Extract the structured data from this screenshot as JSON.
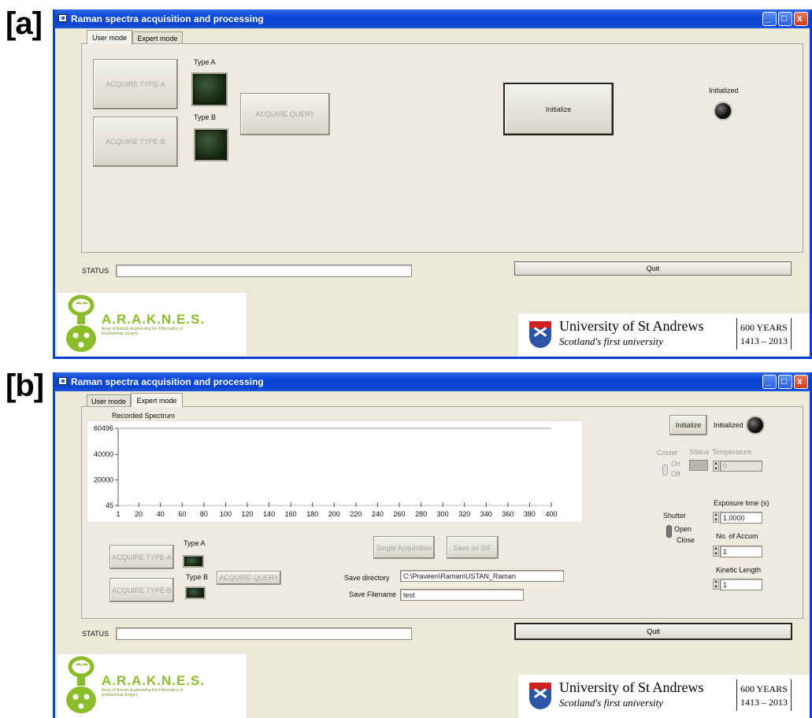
{
  "panel_a": {
    "label": "[a]",
    "title": "Raman spectra acquisition and processing",
    "tabs": [
      "User mode",
      "Expert mode"
    ],
    "buttons": {
      "acquire_a": "ACQUIRE TYPE-A",
      "acquire_b": "ACQUIRE TYPE-B",
      "acquire_query": "ACQUIRE QUERY",
      "initialize": "Initialize",
      "quit": "Quit"
    },
    "labels": {
      "type_a": "Type A",
      "type_b": "Type B",
      "initialized": "Initialized",
      "status": "STATUS"
    },
    "status_value": ""
  },
  "panel_b": {
    "label": "[b]",
    "title": "Raman spectra acquisition and processing",
    "tabs": [
      "User mode",
      "Expert mode"
    ],
    "chart_title": "Recorded Spectrum",
    "buttons": {
      "initialize": "Initialize",
      "acquire_a": "ACQUIRE TYPE-A",
      "acquire_b": "ACQUIRE TYPE-B",
      "acquire_query": "ACQUIRE QUERY",
      "single_acq": "Single Acquisition",
      "save_sif": "Save as SIF",
      "quit": "Quit"
    },
    "labels": {
      "initialized": "Initialized",
      "cooler": "Cooler",
      "status_col": "Status",
      "temperature": "Temperature",
      "on": "On",
      "off": "Off",
      "shutter": "Shutter",
      "open": "Open",
      "close": "Close",
      "exposure": "Exposure time (s)",
      "accum": "No. of Accum",
      "kinetic": "Kinetic Length",
      "type_a": "Type A",
      "type_b": "Type B",
      "save_dir": "Save directory",
      "save_file": "Save Filename",
      "status": "STATUS"
    },
    "values": {
      "temperature": "0",
      "exposure": "1.0000",
      "accum": "1",
      "kinetic": "1",
      "save_dir": "C:\\Praveen\\Raman\\USTAN_Raman",
      "save_file": "test",
      "status": ""
    }
  },
  "chart_data": {
    "type": "line",
    "title": "Recorded Spectrum",
    "x_ticks": [
      "1",
      "20",
      "40",
      "60",
      "80",
      "100",
      "120",
      "140",
      "160",
      "180",
      "200",
      "220",
      "240",
      "260",
      "280",
      "300",
      "320",
      "340",
      "360",
      "380",
      "400"
    ],
    "y_ticks": [
      "60496",
      "40000",
      "20000",
      "45"
    ],
    "xlim": [
      1,
      400
    ],
    "ylim": [
      45,
      60496
    ],
    "series": [
      {
        "x": [
          1,
          400
        ],
        "values": [
          60496,
          60496
        ]
      }
    ]
  },
  "branding": {
    "arakness": "A.R.A.K.N.E.S.",
    "arakness_sub": "Array of Robots Augmenting the KiNematics of Endoluminal Surgery",
    "university": "University of St Andrews",
    "tagline": "Scotland's first university",
    "years": "600 YEARS",
    "range": "1413 – 2013"
  },
  "colors": {
    "titlebar": "#0a46d4",
    "window_bg": "#ece9d8",
    "led": "#14250f",
    "logo_green": "#8bbd2a",
    "logo_orange": "#e0781a"
  }
}
